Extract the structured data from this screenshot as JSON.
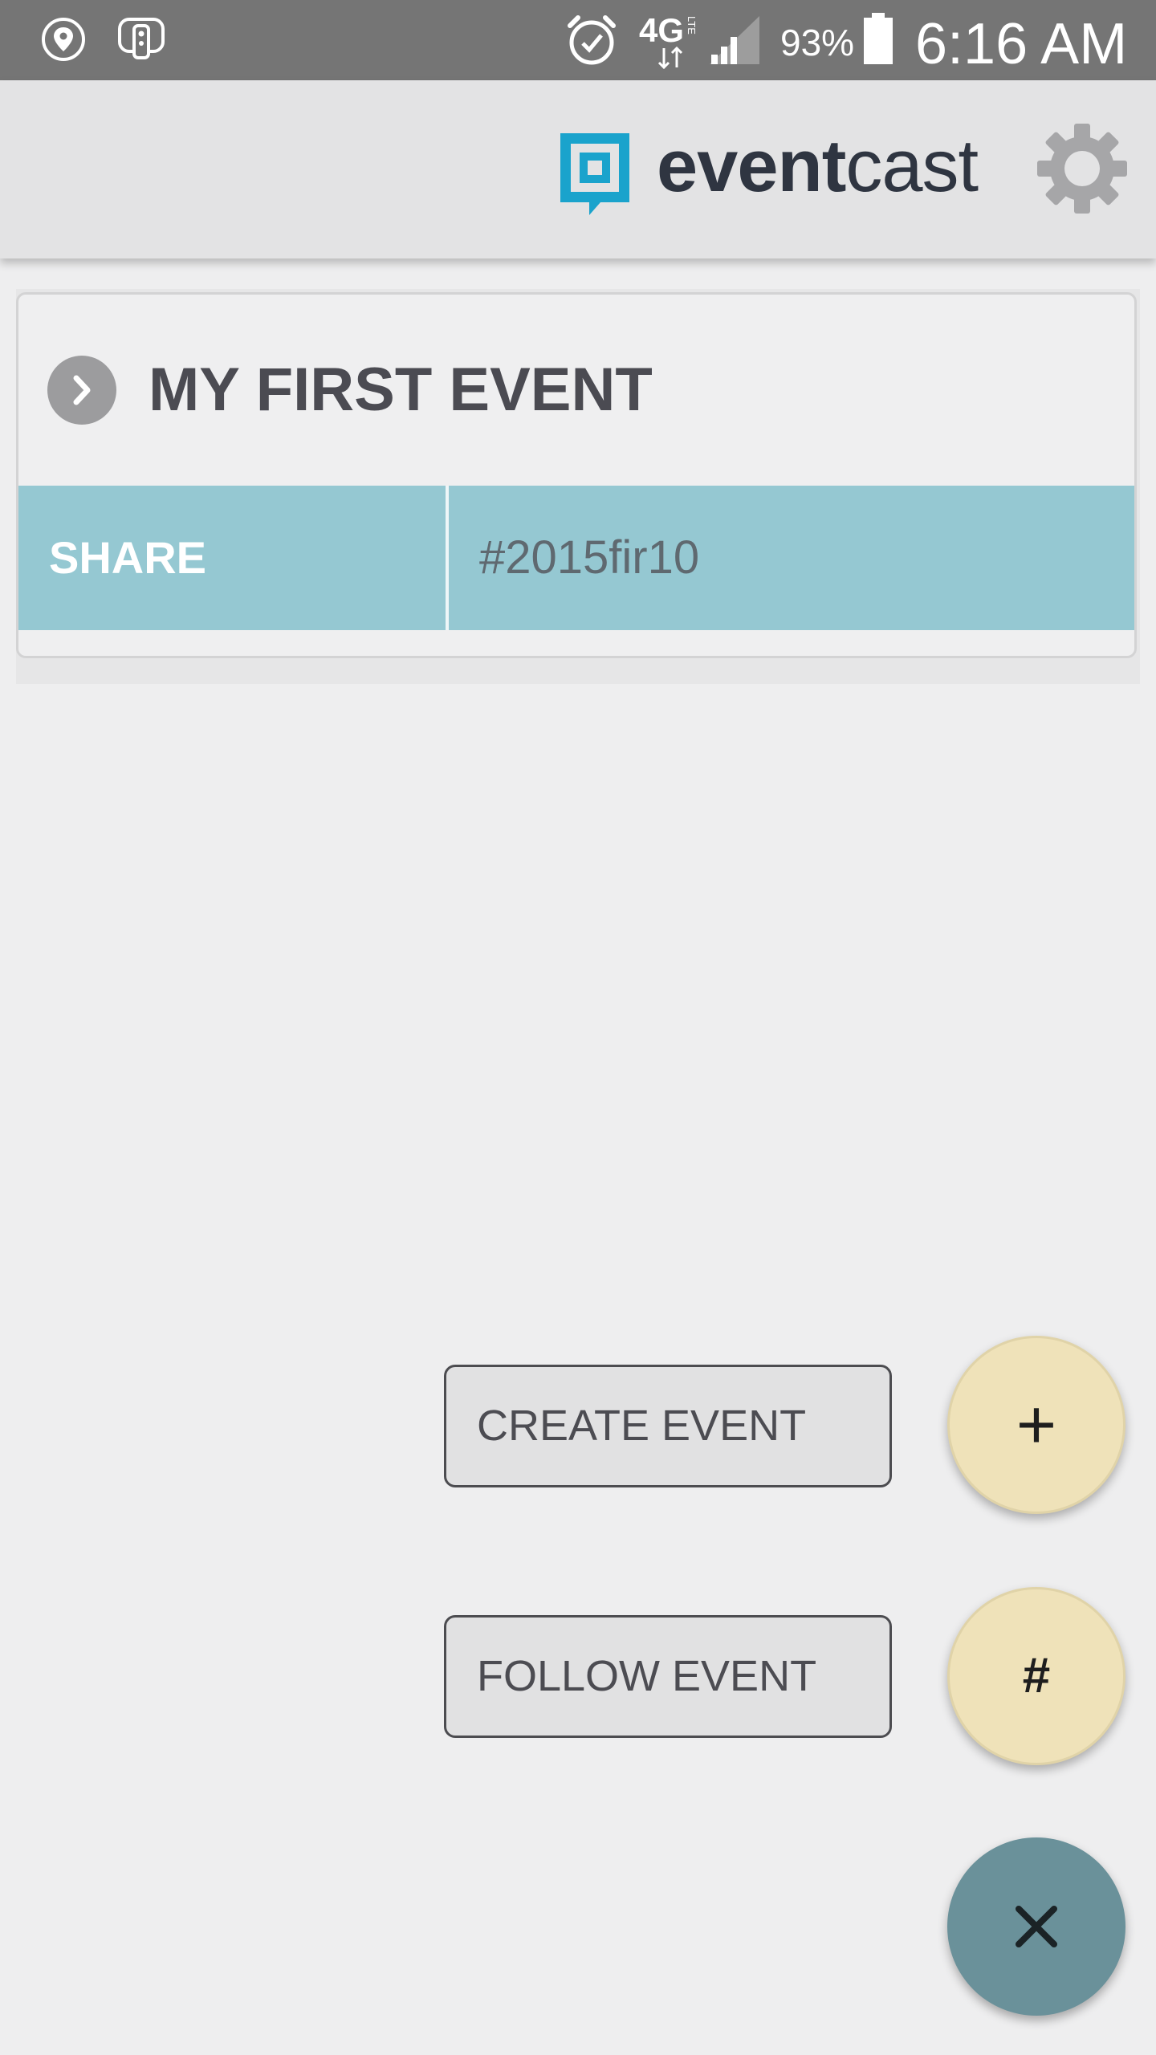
{
  "status_bar": {
    "icons": [
      "location-pin-icon",
      "remote-icon",
      "alarm-icon",
      "network-4g-lte-icon",
      "signal-icon",
      "battery-icon"
    ],
    "network_label": "4G",
    "network_sub_label": "LTE",
    "battery_percent": "93%",
    "time": "6:16 AM"
  },
  "app_bar": {
    "logo_bold": "event",
    "logo_light": "cast",
    "brand_color": "#1aa3cc",
    "settings_icon": "gear-icon"
  },
  "events": [
    {
      "title": "MY FIRST EVENT",
      "share_label": "SHARE",
      "share_code": "#2015fir10",
      "expand_icon": "chevron-right-icon",
      "share_color": "#95c8d2"
    }
  ],
  "speed_dial": {
    "create_label": "CREATE EVENT",
    "create_glyph": "+",
    "follow_label": "FOLLOW EVENT",
    "follow_glyph": "#",
    "mini_fab_color": "#efe2b9",
    "main_fab_color": "#6a919a",
    "close_icon": "close-icon"
  }
}
